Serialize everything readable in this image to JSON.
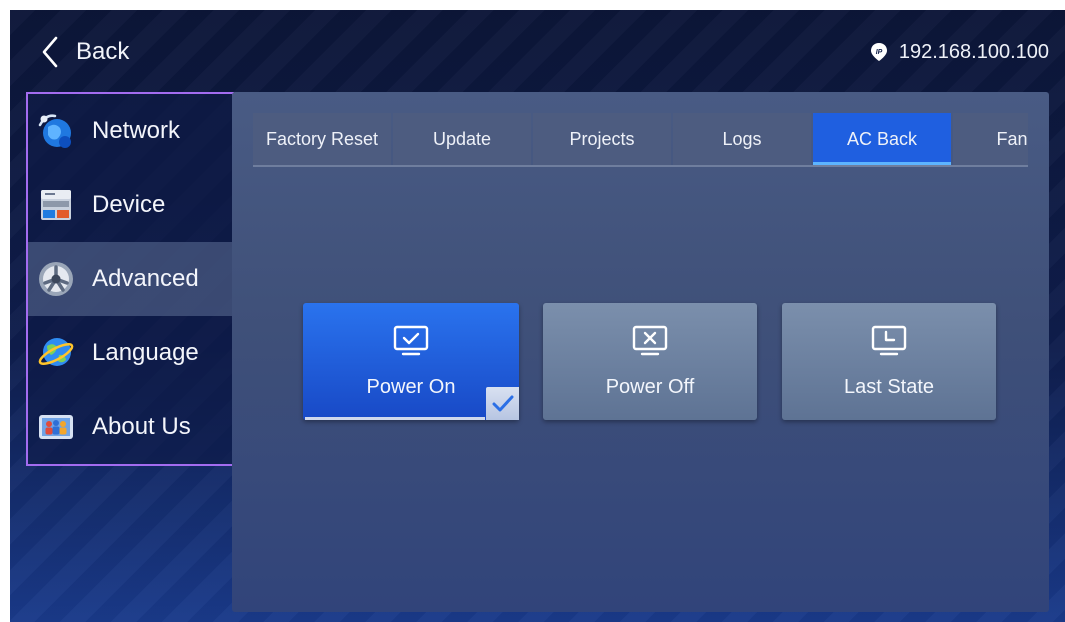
{
  "header": {
    "back_label": "Back",
    "ip_address": "192.168.100.100",
    "back_icon": "chevron-left-icon",
    "ip_icon": "ip-location-pin-icon"
  },
  "sidebar": {
    "items": [
      {
        "label": "Network",
        "icon": "network-globe-icon",
        "active": false
      },
      {
        "label": "Device",
        "icon": "device-server-icon",
        "active": false
      },
      {
        "label": "Advanced",
        "icon": "gear-icon",
        "active": true
      },
      {
        "label": "Language",
        "icon": "globe-orbit-icon",
        "active": false
      },
      {
        "label": "About Us",
        "icon": "people-icon",
        "active": false
      }
    ]
  },
  "tabs": [
    {
      "label": "Factory Reset",
      "active": false
    },
    {
      "label": "Update",
      "active": false
    },
    {
      "label": "Projects",
      "active": false
    },
    {
      "label": "Logs",
      "active": false
    },
    {
      "label": "AC Back",
      "active": true
    },
    {
      "label": "Fan M",
      "active": false
    }
  ],
  "options": [
    {
      "label": "Power On",
      "icon": "monitor-check-icon",
      "selected": true
    },
    {
      "label": "Power Off",
      "icon": "monitor-x-icon",
      "selected": false
    },
    {
      "label": "Last State",
      "icon": "monitor-clock-icon",
      "selected": false
    }
  ],
  "colors": {
    "accent": "#1f5fe0",
    "sidebar_border": "#a36cf0",
    "tab_bg": "#4d5c80",
    "option_bg": "#6d82a2"
  }
}
